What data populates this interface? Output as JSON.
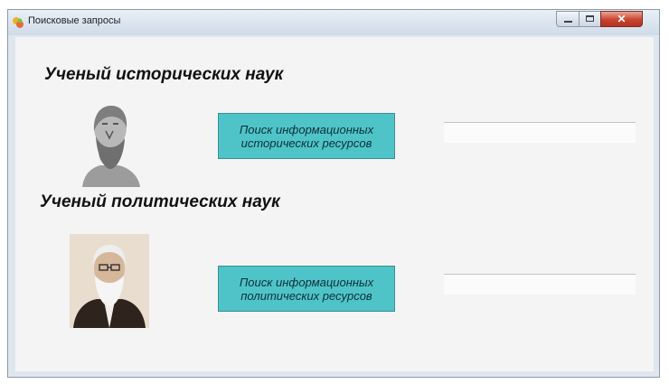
{
  "window": {
    "title": "Поисковые запросы",
    "icon": "app-icon",
    "controls": [
      "minimize-icon",
      "maximize-icon",
      "close-icon"
    ],
    "close_glyph": "✕"
  },
  "sections": [
    {
      "heading": "Ученый исторических наук",
      "image": "ancient-scholar-bust",
      "button_line1": "Поиск информационных",
      "button_line2": "исторических ресурсов",
      "result_value": ""
    },
    {
      "heading": "Ученый политических наук",
      "image": "bearded-scholar-portrait",
      "button_line1": "Поиск информационных",
      "button_line2": "политических ресурсов",
      "result_value": ""
    }
  ],
  "colors": {
    "button_bg": "#4fc4c8",
    "close_button": "#c8442f"
  }
}
